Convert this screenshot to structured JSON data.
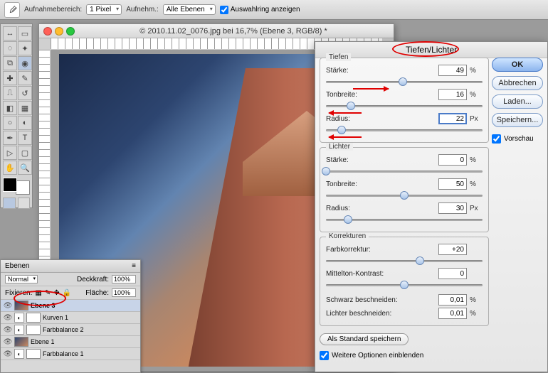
{
  "options": {
    "range_label": "Aufnahmebereich:",
    "range_select": "1 Pixel",
    "sample_label": "Aufnehm.:",
    "sample_select": "Alle Ebenen",
    "ring_label": "Auswahlring anzeigen"
  },
  "doc": {
    "title": "© 2010.11.02_0076.jpg bei 16,7% (Ebene 3, RGB/8) *"
  },
  "layers": {
    "tab": "Ebenen",
    "blend_mode": "Normal",
    "opacity_label": "Deckkraft:",
    "opacity": "100%",
    "lock_label": "Fixieren:",
    "fill_label": "Fläche:",
    "fill": "100%",
    "items": [
      {
        "name": "Ebene 3",
        "type": "image",
        "selected": true
      },
      {
        "name": "Kurven 1",
        "type": "adj"
      },
      {
        "name": "Farbbalance 2",
        "type": "adj"
      },
      {
        "name": "Ebene 1",
        "type": "image"
      },
      {
        "name": "Farbbalance 1",
        "type": "adj"
      }
    ]
  },
  "dialog": {
    "title": "Tiefen/Lichter",
    "ok": "OK",
    "cancel": "Abbrechen",
    "load": "Laden...",
    "save": "Speichern...",
    "preview": "Vorschau",
    "shadows": {
      "legend": "Tiefen",
      "strength_label": "Stärke:",
      "strength": "49",
      "strength_unit": "%",
      "tone_label": "Tonbreite:",
      "tone": "16",
      "tone_unit": "%",
      "radius_label": "Radius:",
      "radius": "22",
      "radius_unit": "Px"
    },
    "highlights": {
      "legend": "Lichter",
      "strength_label": "Stärke:",
      "strength": "0",
      "strength_unit": "%",
      "tone_label": "Tonbreite:",
      "tone": "50",
      "tone_unit": "%",
      "radius_label": "Radius:",
      "radius": "30",
      "radius_unit": "Px"
    },
    "corrections": {
      "legend": "Korrekturen",
      "colorcorr_label": "Farbkorrektur:",
      "colorcorr": "+20",
      "midtone_label": "Mittelton-Kontrast:",
      "midtone": "0",
      "black_clip_label": "Schwarz beschneiden:",
      "black_clip": "0,01",
      "black_clip_unit": "%",
      "white_clip_label": "Lichter beschneiden:",
      "white_clip": "0,01",
      "white_clip_unit": "%"
    },
    "save_default": "Als Standard speichern",
    "more_options": "Weitere Optionen einblenden"
  }
}
